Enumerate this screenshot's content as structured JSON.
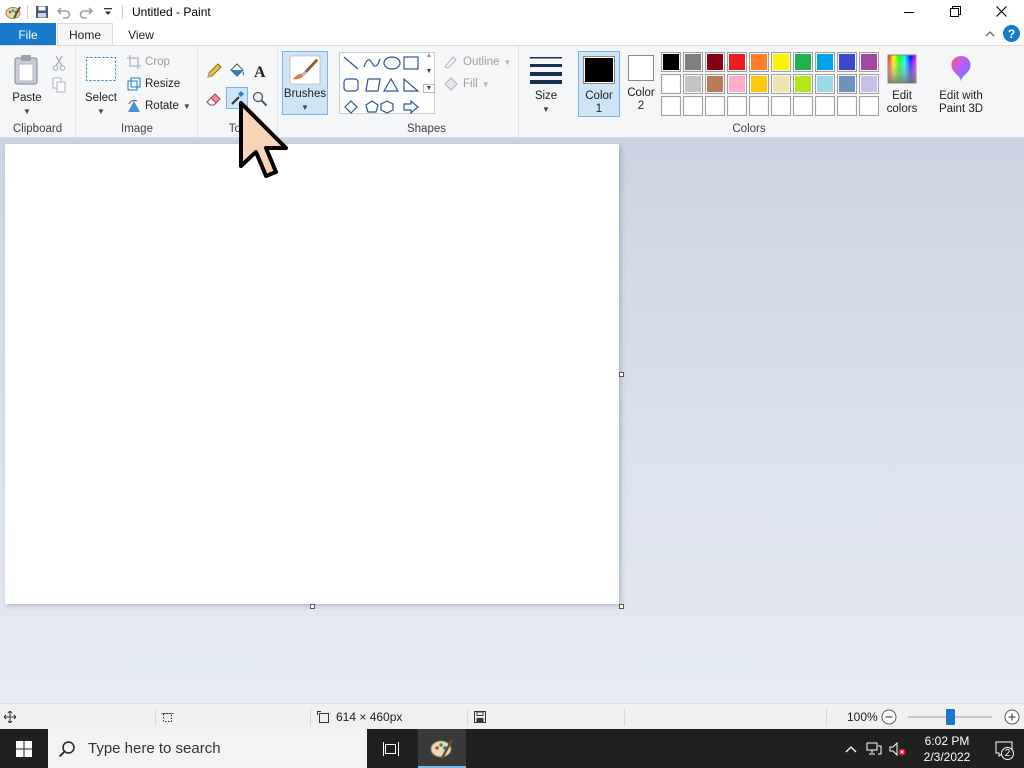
{
  "window": {
    "title": "Untitled - Paint",
    "quick_access": [
      "save-icon",
      "undo-icon",
      "redo-icon",
      "customize-icon"
    ],
    "controls": [
      "minimize-icon",
      "restore-icon",
      "close-icon"
    ]
  },
  "tabs": {
    "file": "File",
    "home": "Home",
    "view": "View"
  },
  "ribbon": {
    "clipboard": {
      "label": "Clipboard",
      "paste": "Paste"
    },
    "image": {
      "label": "Image",
      "select": "Select",
      "crop": "Crop",
      "resize": "Resize",
      "rotate": "Rotate"
    },
    "tools": {
      "label": "Tools",
      "visible_label": "Too"
    },
    "brushes": "Brushes",
    "shapes": {
      "label": "Shapes",
      "outline": "Outline",
      "fill": "Fill"
    },
    "size": "Size",
    "colors": {
      "label": "Colors",
      "color1": "Color",
      "color1_num": "1",
      "color2": "Color",
      "color2_num": "2",
      "edit": "Edit",
      "edit2": "colors",
      "paint3d": "Edit with",
      "paint3d2": "Paint 3D",
      "color1_value": "#000000",
      "color2_value": "#ffffff",
      "palette_row1": [
        "#000000",
        "#7f7f7f",
        "#880015",
        "#ed1c24",
        "#ff7f27",
        "#fff200",
        "#22b14c",
        "#00a2e8",
        "#3f48cc",
        "#a349a4"
      ],
      "palette_row2": [
        "#ffffff",
        "#c3c3c3",
        "#b97a57",
        "#ffaec9",
        "#ffc90e",
        "#efe4b0",
        "#b5e61d",
        "#99d9ea",
        "#7092be",
        "#c8bfe7"
      ],
      "palette_row3": [
        "#ffffff",
        "#ffffff",
        "#ffffff",
        "#ffffff",
        "#ffffff",
        "#ffffff",
        "#ffffff",
        "#ffffff",
        "#ffffff",
        "#ffffff"
      ]
    }
  },
  "status": {
    "dimensions": "614 × 460px",
    "zoom": "100%",
    "zoom_level": 0.5
  },
  "taskbar": {
    "search_placeholder": "Type here to search",
    "time": "6:02 PM",
    "date": "2/3/2022",
    "notifications": "2"
  }
}
